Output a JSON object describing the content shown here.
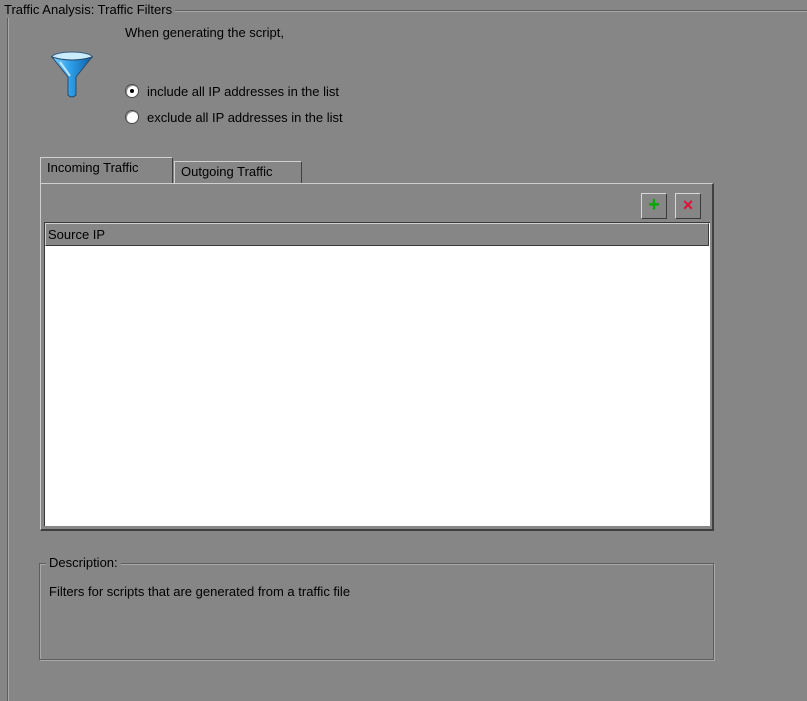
{
  "group": {
    "title": "Traffic Analysis: Traffic Filters"
  },
  "intro": {
    "text": "When generating the script,"
  },
  "filter_mode": {
    "options": [
      {
        "label": "include all IP addresses in the list",
        "checked": true
      },
      {
        "label": "exclude all IP addresses in the list",
        "checked": false
      }
    ]
  },
  "tabs": [
    {
      "label": "Incoming Traffic",
      "active": true
    },
    {
      "label": "Outgoing Traffic",
      "active": false
    }
  ],
  "toolbar": {
    "add_glyph": "+",
    "delete_glyph": "×"
  },
  "list": {
    "columns": [
      "Source IP"
    ],
    "rows": []
  },
  "description": {
    "title": "Description:",
    "text": "Filters for scripts that are generated from a traffic file"
  },
  "colors": {
    "background": "#868686",
    "add_icon": "#00a800",
    "delete_icon": "#e0103a",
    "funnel": "#1c7fc8"
  },
  "icons": {
    "filter": "funnel-icon",
    "add": "plus-icon",
    "delete": "close-icon"
  }
}
